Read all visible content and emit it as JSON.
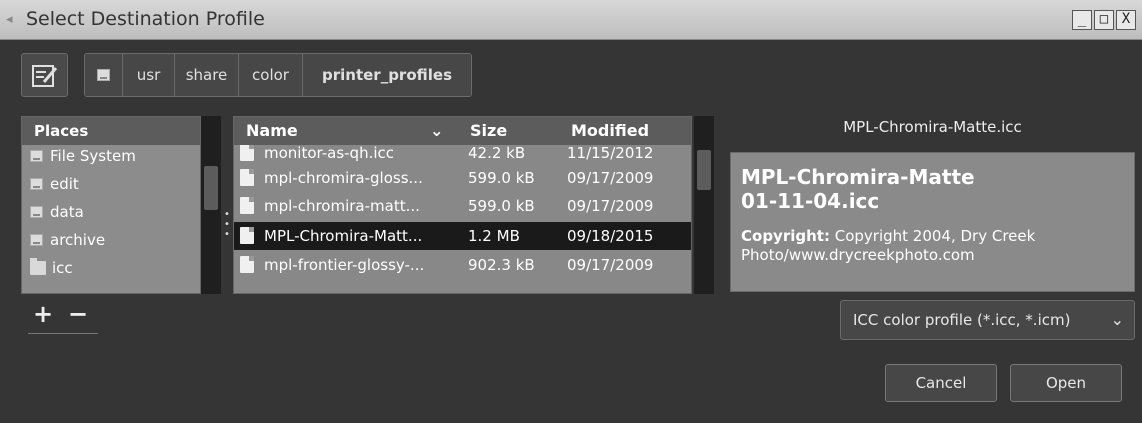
{
  "window": {
    "title": "Select Destination Profile",
    "controls": {
      "minimize": "_",
      "maximize": "□",
      "close": "X"
    }
  },
  "breadcrumbs": [
    "usr",
    "share",
    "color",
    "printer_profiles"
  ],
  "places": {
    "header": "Places",
    "items": [
      {
        "label": "File System",
        "icon": "drive-icon"
      },
      {
        "label": "edit",
        "icon": "drive-icon"
      },
      {
        "label": "data",
        "icon": "drive-icon"
      },
      {
        "label": "archive",
        "icon": "drive-icon"
      },
      {
        "label": "icc",
        "icon": "folder-icon"
      }
    ],
    "add": "+",
    "remove": "−"
  },
  "files": {
    "columns": {
      "name": "Name",
      "size": "Size",
      "modified": "Modified"
    },
    "rows": [
      {
        "name": "monitor-as-qh.icc",
        "size": "42.2 kB",
        "modified": "11/15/2012"
      },
      {
        "name": "mpl-chromira-gloss...",
        "size": "599.0 kB",
        "modified": "09/17/2009"
      },
      {
        "name": "mpl-chromira-matt...",
        "size": "599.0 kB",
        "modified": "09/17/2009"
      },
      {
        "name": "MPL-Chromira-Matt...",
        "size": "1.2 MB",
        "modified": "09/18/2015"
      },
      {
        "name": "mpl-frontier-glossy-...",
        "size": "902.3 kB",
        "modified": "09/17/2009"
      }
    ]
  },
  "preview": {
    "filename": "MPL-Chromira-Matte.icc",
    "title_line1": "MPL-Chromira-Matte",
    "title_line2": "01-11-04.icc",
    "copyright_label": "Copyright:",
    "copyright_text": "Copyright 2004, Dry Creek Photo/www.drycreekphoto.com"
  },
  "filter": {
    "selected": "ICC color profile (*.icc, *.icm)"
  },
  "buttons": {
    "cancel": "Cancel",
    "open": "Open"
  }
}
